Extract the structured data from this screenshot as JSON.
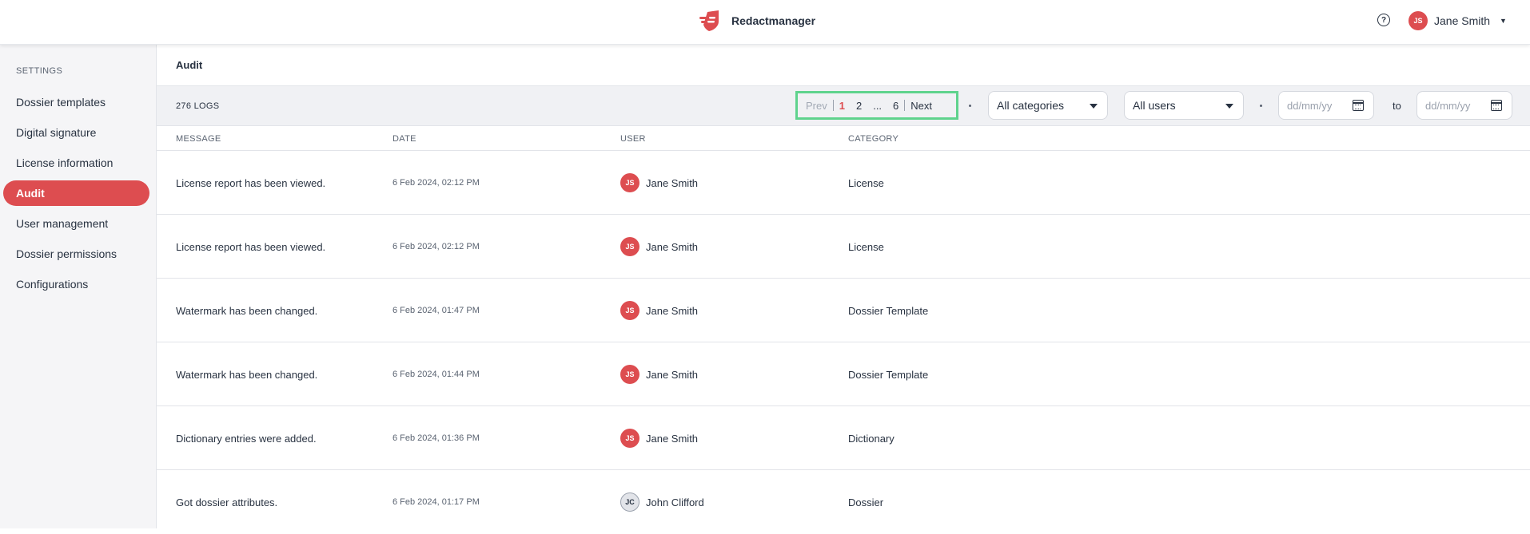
{
  "app": {
    "name": "Redactmanager",
    "logo_icon": "redactmanager-logo-icon"
  },
  "header": {
    "help_icon": "help-circle-icon",
    "user": {
      "initials": "JS",
      "name": "Jane Smith"
    }
  },
  "sidebar": {
    "heading": "SETTINGS",
    "items": [
      {
        "label": "Dossier templates"
      },
      {
        "label": "Digital signature"
      },
      {
        "label": "License information"
      },
      {
        "label": "Audit",
        "active": true
      },
      {
        "label": "User management"
      },
      {
        "label": "Dossier permissions"
      },
      {
        "label": "Configurations"
      }
    ]
  },
  "page": {
    "title": "Audit"
  },
  "toolbar": {
    "logs_count": "276 LOGS",
    "pagination": {
      "prev": "Prev",
      "pages": [
        "1",
        "2",
        "...",
        "6"
      ],
      "current": "1",
      "next": "Next"
    },
    "category_select": "All categories",
    "user_select": "All users",
    "date_from_placeholder": "dd/mm/yy",
    "date_to_placeholder": "dd/mm/yy",
    "to_label": "to"
  },
  "table": {
    "columns": [
      "MESSAGE",
      "DATE",
      "USER",
      "CATEGORY"
    ],
    "rows": [
      {
        "message": "License report has been viewed.",
        "date": "6 Feb 2024, 02:12 PM",
        "user_initials": "JS",
        "user": "Jane Smith",
        "category": "License"
      },
      {
        "message": "License report has been viewed.",
        "date": "6 Feb 2024, 02:12 PM",
        "user_initials": "JS",
        "user": "Jane Smith",
        "category": "License"
      },
      {
        "message": "Watermark has been changed.",
        "date": "6 Feb 2024, 01:47 PM",
        "user_initials": "JS",
        "user": "Jane Smith",
        "category": "Dossier Template"
      },
      {
        "message": "Watermark has been changed.",
        "date": "6 Feb 2024, 01:44 PM",
        "user_initials": "JS",
        "user": "Jane Smith",
        "category": "Dossier Template"
      },
      {
        "message": "Dictionary entries were added.",
        "date": "6 Feb 2024, 01:36 PM",
        "user_initials": "JS",
        "user": "Jane Smith",
        "category": "Dictionary"
      },
      {
        "message": "Got dossier attributes.",
        "date": "6 Feb 2024, 01:17 PM",
        "user_initials": "JC",
        "user": "John Clifford",
        "category": "Dossier"
      }
    ]
  },
  "colors": {
    "accent": "#dd4d50",
    "highlight": "#5fd38d",
    "sidebar_bg": "#f5f5f7",
    "toolbar_bg": "#f0f1f4"
  }
}
